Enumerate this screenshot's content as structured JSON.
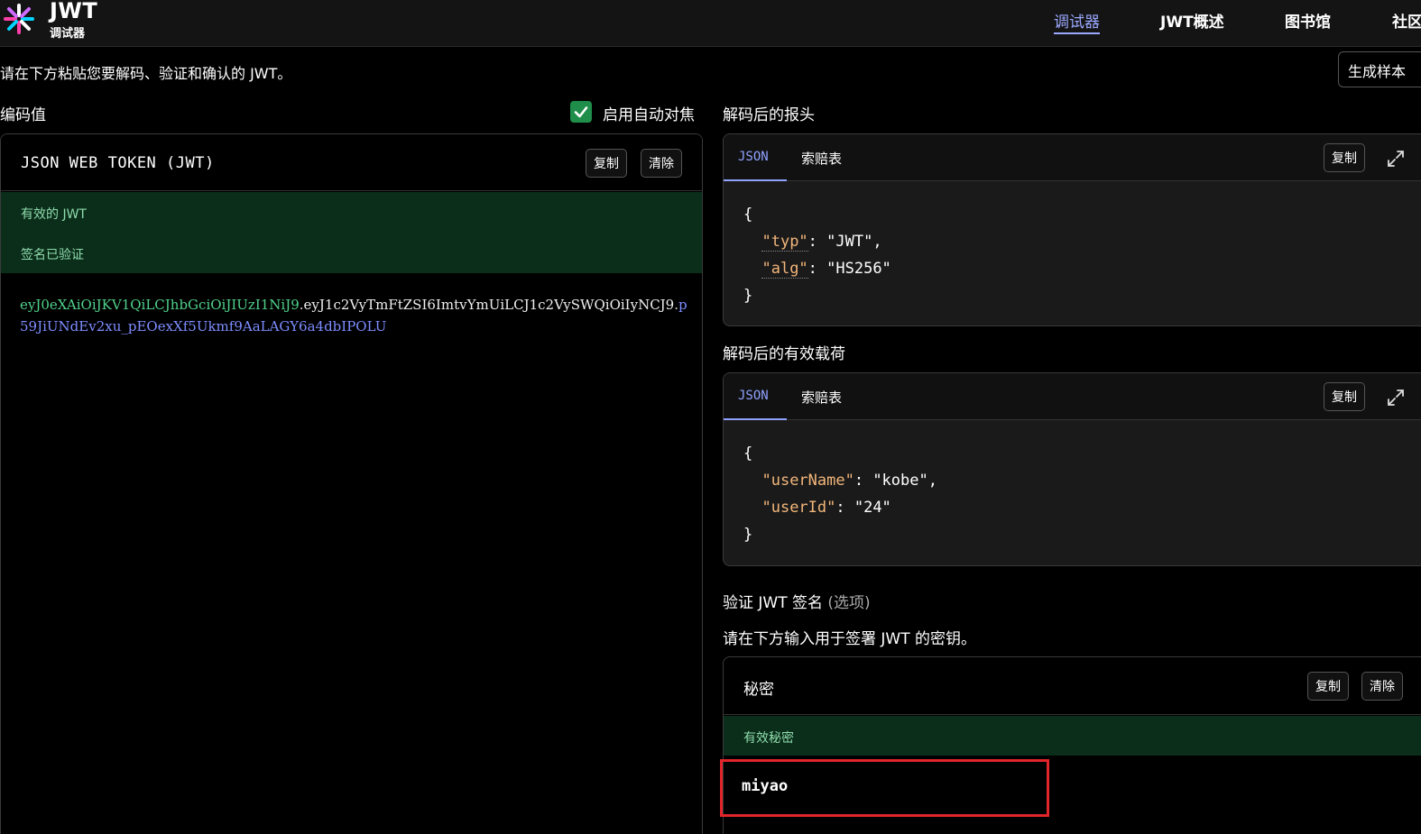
{
  "header": {
    "brand_title": "JWT",
    "brand_sub": "调试器",
    "nav": [
      {
        "label": "调试器",
        "active": true
      },
      {
        "label": "JWT概述",
        "active": false
      },
      {
        "label": "图书馆",
        "active": false
      },
      {
        "label": "社区",
        "active": false
      }
    ]
  },
  "hint": "请在下方粘贴您要解码、验证和确认的 JWT。",
  "generate_button": "生成样本",
  "encoded": {
    "label": "编码值",
    "autofocus_label": "启用自动对焦",
    "autofocus_checked": true,
    "panel_title": "JSON WEB TOKEN (JWT)",
    "copy": "复制",
    "clear": "清除",
    "status_valid": "有效的 JWT",
    "status_signature": "签名已验证",
    "token_header": "eyJ0eXAiOiJKV1QiLCJhbGciOiJIUzI1NiJ9",
    "token_payload": "eyJ1c2VyTmFtZSI6ImtvYmUiLCJ1c2VySWQiOiIyNCJ9",
    "token_signature": "p59JiUNdEv2xu_pEOexXf5Ukmf9AaLAGY6a4dbIPOLU",
    "dot": "."
  },
  "decoded_header": {
    "label": "解码后的报头",
    "tab_json": "JSON",
    "tab_claims": "索赔表",
    "copy": "复制",
    "open_brace": "{",
    "close_brace": "}",
    "lines": [
      {
        "key": "\"typ\"",
        "value": ": \"JWT\","
      },
      {
        "key": "\"alg\"",
        "value": ": \"HS256\""
      }
    ]
  },
  "decoded_payload": {
    "label": "解码后的有效载荷",
    "tab_json": "JSON",
    "tab_claims": "索赔表",
    "copy": "复制",
    "open_brace": "{",
    "close_brace": "}",
    "lines": [
      {
        "key": "\"userName\"",
        "value": ": \"kobe\","
      },
      {
        "key": "\"userId\"",
        "value": ": \"24\""
      }
    ]
  },
  "verify": {
    "title": "验证 JWT 签名",
    "optional": "(选项)",
    "hint": "请在下方输入用于签署 JWT 的密钥。",
    "secret_label": "秘密",
    "copy": "复制",
    "clear": "清除",
    "status": "有效秘密",
    "secret_value": "miyao"
  },
  "colors": {
    "accent": "#9aa8ff",
    "valid_bg": "#0b2e1b",
    "valid_text": "#8fdcac",
    "token_header": "#4fd18a",
    "token_signature": "#7d8dff",
    "json_key": "#f2b67a",
    "highlight": "#e0252b"
  }
}
